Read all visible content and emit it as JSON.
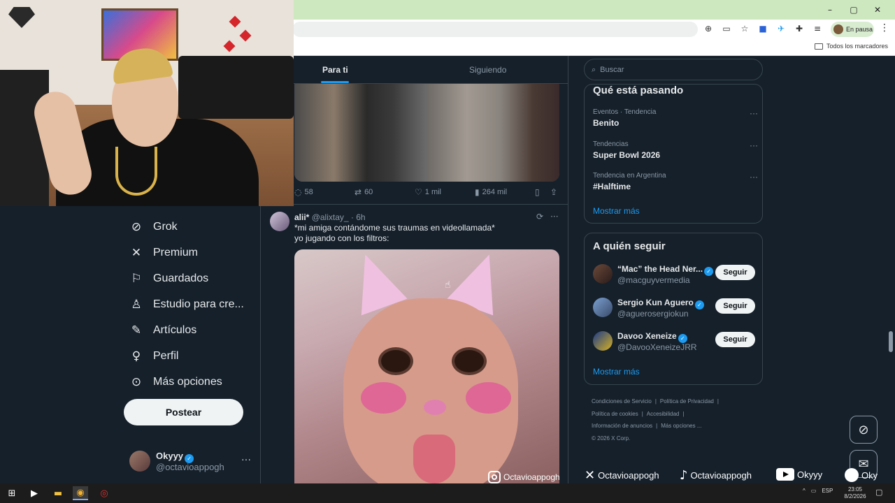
{
  "browser": {
    "window_controls": [
      "–",
      "▢",
      "✕"
    ],
    "profile_status": "En pausa",
    "bookmarks_all": "Todos los marcadores",
    "toolbar_icons": [
      "zoom-icon",
      "install-icon",
      "star-icon",
      "extension-a-icon",
      "extension-b-icon",
      "puzzle-icon",
      "media-icon"
    ]
  },
  "nav": {
    "items": [
      {
        "icon": "grok-icon",
        "label": "Grok"
      },
      {
        "icon": "x-logo-icon",
        "label": "Premium"
      },
      {
        "icon": "bookmark-icon",
        "label": "Guardados"
      },
      {
        "icon": "creator-studio-icon",
        "label": "Estudio para cre..."
      },
      {
        "icon": "articles-icon",
        "label": "Artículos"
      },
      {
        "icon": "profile-icon",
        "label": "Perfil"
      },
      {
        "icon": "more-icon",
        "label": "Más opciones"
      }
    ],
    "post_label": "Postear",
    "account": {
      "name": "Okyyy",
      "handle": "@octavioappogh",
      "more": "···"
    }
  },
  "tabs": [
    {
      "label": "Para ti",
      "active": true
    },
    {
      "label": "Siguiendo",
      "active": false
    }
  ],
  "tweet1_actions": {
    "replies": "58",
    "reposts": "60",
    "likes": "1 mil",
    "views": "264 mil"
  },
  "tweet2": {
    "name": "alii*",
    "handle": "@alixtay_",
    "time": "· 6h",
    "line1": "*mi amiga contándome sus traumas en videollamada*",
    "line2": "yo jugando con los filtros:",
    "more": "···"
  },
  "search": {
    "placeholder": "Buscar"
  },
  "trends": {
    "title": "Qué está pasando",
    "items": [
      {
        "category": "Eventos · Tendencia",
        "name": "Benito"
      },
      {
        "category": "Tendencias",
        "name": "Super Bowl 2026"
      },
      {
        "category": "Tendencia en Argentina",
        "name": "#Halftime"
      }
    ],
    "show_more": "Mostrar más",
    "more_glyph": "···"
  },
  "who_to_follow": {
    "title": "A quién seguir",
    "items": [
      {
        "name": "“Mac” the Head Ner...",
        "handle": "@macguyvermedia",
        "button": "Seguir"
      },
      {
        "name": "Sergio Kun Aguero",
        "handle": "@aguerosergiokun",
        "button": "Seguir"
      },
      {
        "name": "Davoo Xeneize",
        "handle": "@DavooXeneizeJRR",
        "button": "Seguir"
      }
    ],
    "show_more": "Mostrar más"
  },
  "footer": {
    "links": [
      "Condiciones de Servicio",
      "Política de Privacidad",
      "Política de cookies",
      "Accesibilidad",
      "Información de anuncios",
      "Más opciones ..."
    ],
    "copyright": "© 2026 X Corp."
  },
  "stream_overlay": {
    "watermark": "Octavioappogh",
    "socials": [
      {
        "icon": "x-logo-icon",
        "label": "Octavioappogh"
      },
      {
        "icon": "tiktok-icon",
        "label": "Octavioappogh"
      },
      {
        "icon": "youtube-icon",
        "label": "Okyyy"
      },
      {
        "icon": "spotify-icon",
        "label": "Oky"
      }
    ]
  },
  "taskbar": {
    "lang": "ESP",
    "time": "23:05",
    "date": "8/2/2026"
  },
  "colors": {
    "background": "#15202b",
    "accent": "#1d9bf0",
    "border": "#38444d",
    "muted": "#8b98a5",
    "titlebar": "#cde7bf"
  }
}
